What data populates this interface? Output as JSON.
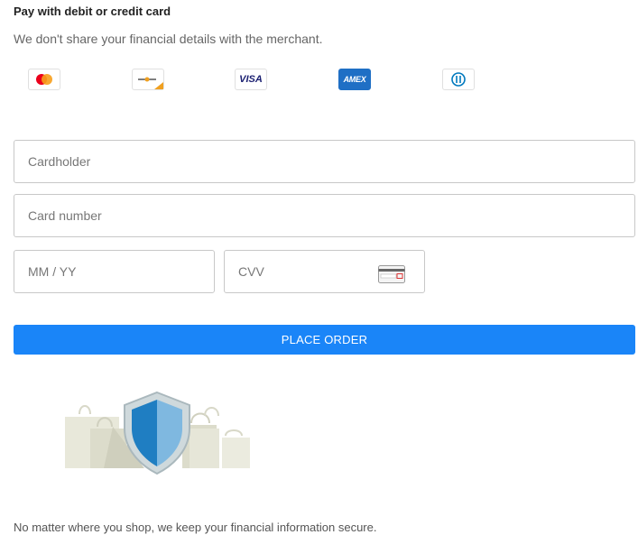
{
  "header": {
    "title": "Pay with debit or credit card",
    "subtitle": "We don't share your financial details with the merchant."
  },
  "card_brands": [
    {
      "name": "mastercard",
      "label": ""
    },
    {
      "name": "discover",
      "label": ""
    },
    {
      "name": "visa",
      "label": "VISA"
    },
    {
      "name": "amex",
      "label": "AMEX"
    },
    {
      "name": "diners",
      "label": ""
    }
  ],
  "form": {
    "cardholder_placeholder": "Cardholder",
    "card_number_placeholder": "Card number",
    "expiry_placeholder": "MM / YY",
    "cvv_placeholder": "CVV"
  },
  "actions": {
    "place_order_label": "PLACE ORDER"
  },
  "footer": {
    "text": "No matter where you shop, we keep your financial information secure."
  },
  "colors": {
    "accent": "#1a85f8",
    "amex_blue": "#1f6fc5",
    "visa_blue": "#1a1f71",
    "mastercard_red": "#eb001b",
    "mastercard_orange": "#f79e1b",
    "shield_dark": "#1f7ec2",
    "shield_light": "#7fb8e0"
  },
  "icons": [
    "mastercard-icon",
    "discover-icon",
    "visa-icon",
    "amex-icon",
    "diners-club-icon",
    "cvv-card-icon",
    "security-shield-icon",
    "shopping-bags-icon"
  ]
}
